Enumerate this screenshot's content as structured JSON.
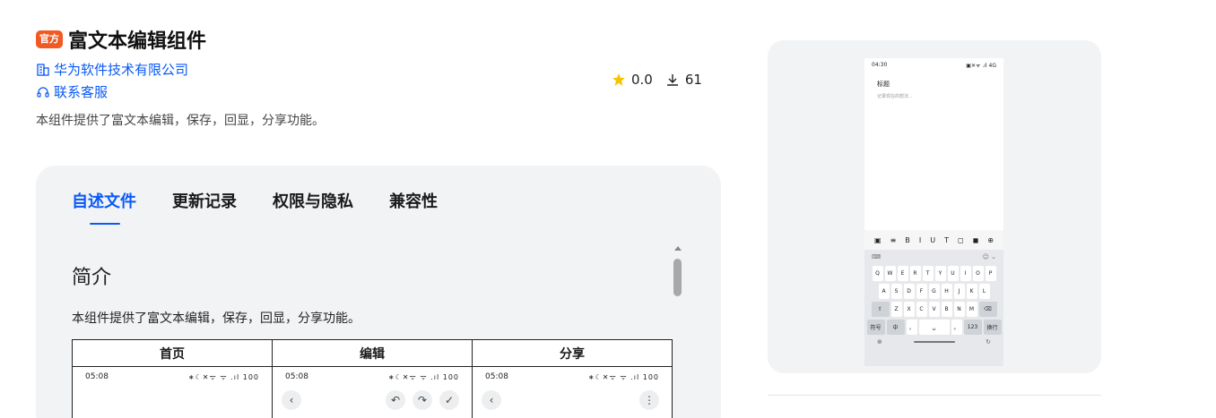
{
  "header": {
    "badge": "官方",
    "title": "富文本编辑组件",
    "vendor": "华为软件技术有限公司",
    "service": "联系客服",
    "description": "本组件提供了富文本编辑，保存，回显，分享功能。",
    "rating": "0.0",
    "downloads": "61"
  },
  "tabs": [
    {
      "label": "自述文件",
      "active": true
    },
    {
      "label": "更新记录",
      "active": false
    },
    {
      "label": "权限与隐私",
      "active": false
    },
    {
      "label": "兼容性",
      "active": false
    }
  ],
  "readme": {
    "section_title": "简介",
    "section_desc": "本组件提供了富文本编辑，保存，回显，分享功能。",
    "table_headers": [
      "首页",
      "编辑",
      "分享"
    ],
    "screens": [
      {
        "time": "05:08",
        "status": "∗☾✕ᯤ ᯤ .ıl 100"
      },
      {
        "time": "05:08",
        "status": "∗☾✕ᯤ ᯤ .ıl 100"
      },
      {
        "time": "05:08",
        "status": "∗☾✕ᯤ ᯤ .ıl 100"
      }
    ]
  },
  "preview": {
    "time": "04:30",
    "status": "▣✕ᯤ .ıl 4G",
    "note_title": "标题",
    "note_placeholder": "记录现在的想法...",
    "toolbar": [
      "▣",
      "≡",
      "B",
      "I",
      "U",
      "T",
      "◻",
      "◼",
      "⊕"
    ],
    "keyboard_rows": [
      [
        "Q",
        "W",
        "E",
        "R",
        "T",
        "Y",
        "U",
        "I",
        "O",
        "P"
      ],
      [
        "A",
        "S",
        "D",
        "F",
        "G",
        "H",
        "J",
        "K",
        "L"
      ],
      [
        "Z",
        "X",
        "C",
        "V",
        "B",
        "N",
        "M"
      ]
    ],
    "keyboard_bottom": [
      "符号",
      "中",
      "，",
      "。",
      "123",
      "换行"
    ]
  },
  "colors": {
    "accent": "#0a59f7",
    "badge": "#f25a24",
    "card": "#f1f3f5"
  },
  "icons": [
    "building-icon",
    "headset-icon",
    "star-icon",
    "download-icon"
  ]
}
